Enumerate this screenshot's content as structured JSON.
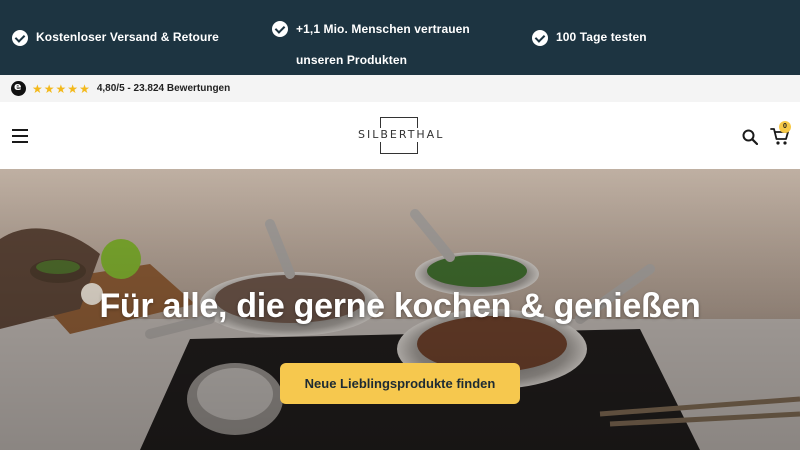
{
  "usp_bar": {
    "items": [
      {
        "text": "Kostenloser Versand & Retoure"
      },
      {
        "text": "+1,1 Mio. Menschen vertrauen unseren Produkten"
      },
      {
        "text": "100 Tage testen"
      }
    ]
  },
  "rating": {
    "stars": 5,
    "score_text": "4,80/5 - 23.824 Bewertungen"
  },
  "header": {
    "logo_text": "SILBERTHAL",
    "menu_icon": "hamburger-menu-icon",
    "search_icon": "search-icon",
    "cart_icon": "cart-icon",
    "cart_count": "0"
  },
  "hero": {
    "title": "Für alle, die gerne kochen & genießen",
    "cta_label": "Neue Lieblingsprodukte finden"
  },
  "colors": {
    "usp_bg": "#1d3441",
    "accent_yellow": "#f6c84e",
    "star_color": "#f3b91b"
  }
}
